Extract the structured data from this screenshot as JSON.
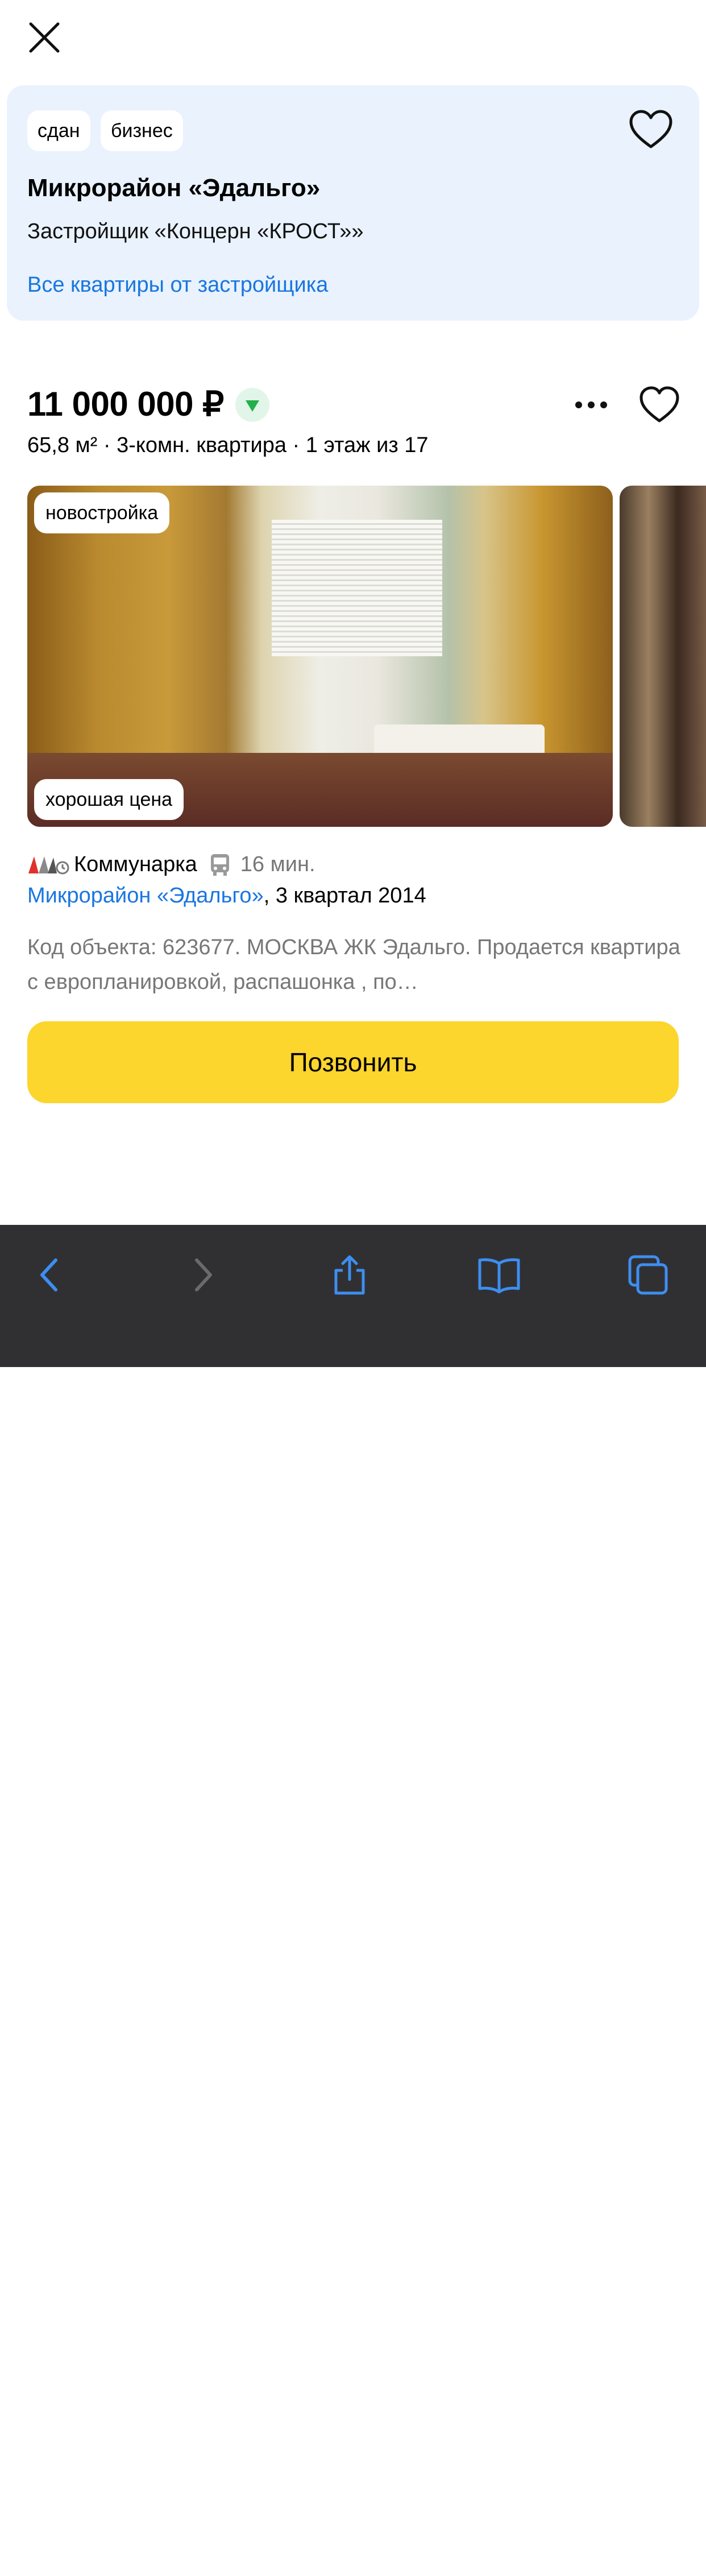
{
  "card": {
    "chips": [
      "сдан",
      "бизнес"
    ],
    "title": "Микрорайон «Эдальго»",
    "developer": "Застройщик «Концерн «КРОСТ»»",
    "link": "Все квартиры от застройщика"
  },
  "listing": {
    "price": "11 000 000 ₽",
    "details": "65,8 м² · 3-комн. квартира · 1 этаж из 17",
    "photo_tags": [
      "новостройка",
      "хорошая цена"
    ],
    "metro_name": "Коммунарка",
    "metro_time": "16 мин.",
    "complex_link": "Микрорайон «Эдальго»",
    "complex_rest": ", 3 квартал 2014",
    "description": "Код объекта: 623677. МОСКВА ЖК Эдальго. Продается квартира с европланировкой, распашонка , по…",
    "call_button": "Позвонить"
  },
  "toolbar": {
    "icons": [
      "back-icon",
      "forward-icon",
      "share-icon",
      "bookmarks-icon",
      "tabs-icon"
    ]
  },
  "colors": {
    "accent": "#1976e0",
    "call": "#fcd52d",
    "card_bg": "#e9f2fd",
    "toolbar": "#303033"
  }
}
